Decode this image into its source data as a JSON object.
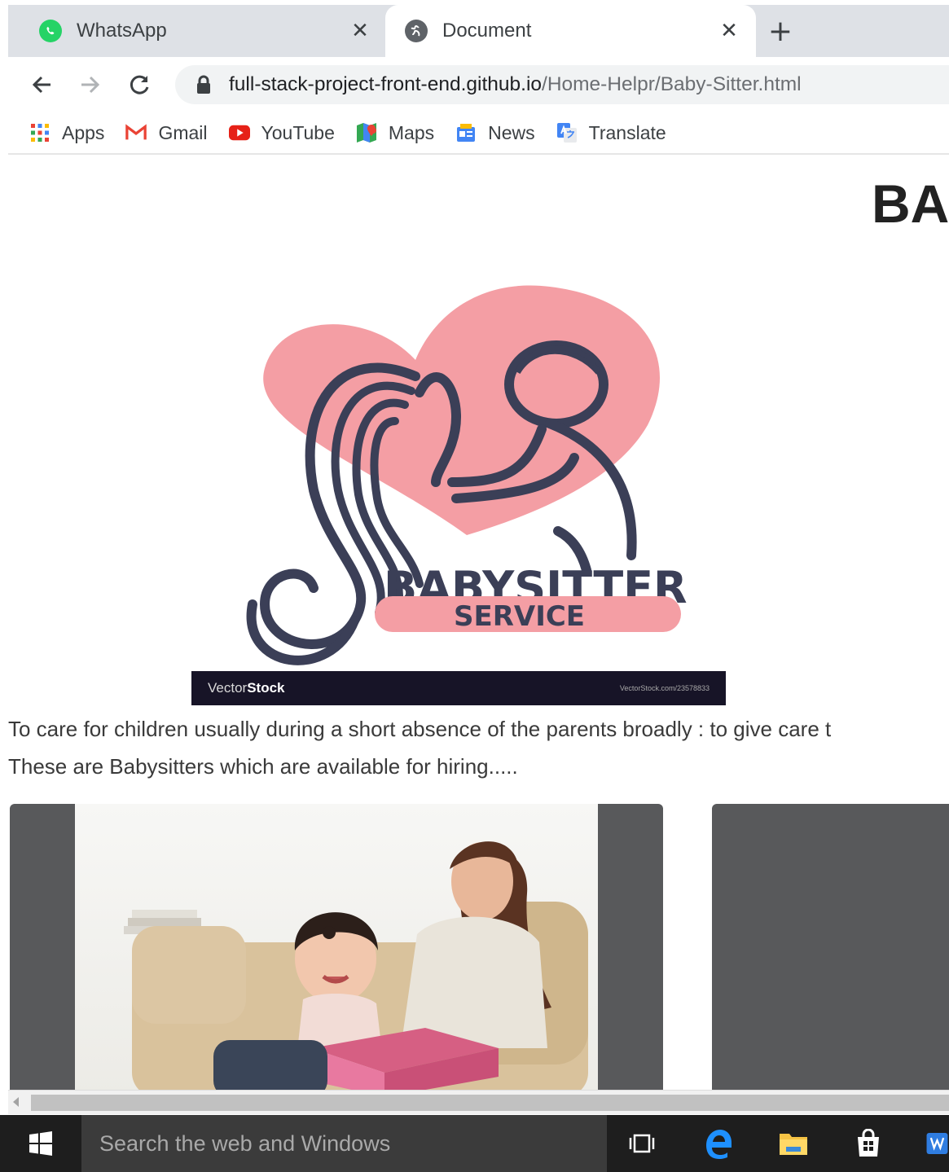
{
  "tabs": [
    {
      "title": "WhatsApp",
      "icon": "whatsapp-icon",
      "active": false
    },
    {
      "title": "Document",
      "icon": "globe-icon",
      "active": true
    }
  ],
  "toolbar": {
    "url_host": "full-stack-project-front-end.github.io",
    "url_path": "/Home-Helpr/Baby-Sitter.html"
  },
  "bookmarks": [
    {
      "label": "Apps",
      "icon": "apps-grid-icon"
    },
    {
      "label": "Gmail",
      "icon": "gmail-icon"
    },
    {
      "label": "YouTube",
      "icon": "youtube-icon"
    },
    {
      "label": "Maps",
      "icon": "maps-icon"
    },
    {
      "label": "News",
      "icon": "news-icon"
    },
    {
      "label": "Translate",
      "icon": "translate-icon"
    }
  ],
  "page": {
    "title": "BA",
    "logo_text_top": "BABYSITTER",
    "logo_text_bottom": "SERVICE",
    "watermark_brand_light": "Vector",
    "watermark_brand_bold": "Stock",
    "watermark_id": "VectorStock.com/23578833",
    "description_line1": "To care for children usually during a short absence of the parents broadly : to give care t",
    "description_line2": "These are Babysitters which are available for hiring....."
  },
  "taskbar": {
    "search_placeholder": "Search the web and Windows"
  },
  "colors": {
    "logo_pink": "#f49ea4",
    "logo_navy": "#3b3f57",
    "card_gray": "#58595b",
    "taskbar": "#1e1e1e"
  }
}
